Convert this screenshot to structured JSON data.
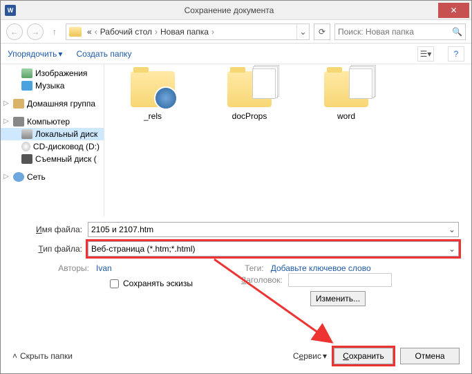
{
  "titlebar": {
    "title": "Сохранение документа",
    "app_letter": "W"
  },
  "nav": {
    "crumbs": [
      "Рабочий стол",
      "Новая папка"
    ],
    "prefix": "«",
    "search_placeholder": "Поиск: Новая папка"
  },
  "toolbar": {
    "organize": "Упорядочить",
    "newfolder": "Создать папку"
  },
  "sidebar": {
    "items": [
      {
        "label": "Изображения",
        "icon": "ico-pic"
      },
      {
        "label": "Музыка",
        "icon": "ico-music"
      },
      {
        "label": "Домашняя группа",
        "icon": "ico-home",
        "group": true
      },
      {
        "label": "Компьютер",
        "icon": "ico-pc",
        "group": true
      },
      {
        "label": "Локальный диск",
        "icon": "ico-drive",
        "sel": true
      },
      {
        "label": "CD-дисковод (D:)",
        "icon": "ico-cd"
      },
      {
        "label": "Съемный диск (",
        "icon": "ico-usb"
      },
      {
        "label": "Сеть",
        "icon": "ico-net",
        "group": true,
        "cut": true
      }
    ]
  },
  "content": {
    "folders": [
      {
        "name": "_rels",
        "variant": "rels"
      },
      {
        "name": "docProps",
        "variant": "papers"
      },
      {
        "name": "word",
        "variant": "papers"
      }
    ]
  },
  "form": {
    "filename_label": "Имя файла:",
    "filename_value": "2105 и 2107.htm",
    "filetype_label": "Тип файла:",
    "filetype_value": "Веб-страница (*.htm;*.html)",
    "authors_label": "Авторы:",
    "authors_value": "Ivan",
    "tags_label": "Теги:",
    "tags_value": "Добавьте ключевое слово",
    "save_thumb": "Сохранять эскизы",
    "title_label": "Заголовок:",
    "change_btn": "Изменить..."
  },
  "bottom": {
    "hide_folders": "Скрыть папки",
    "service": "Сервис",
    "save": "Сохранить",
    "cancel": "Отмена"
  }
}
